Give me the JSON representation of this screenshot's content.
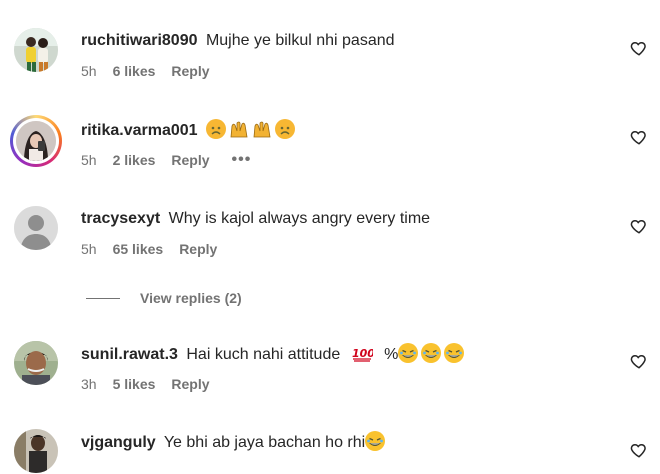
{
  "comments": [
    {
      "username": "ruchitiwari8090",
      "text": "Mujhe ye bilkul nhi pasand",
      "time": "5h",
      "likes": "6 likes",
      "reply": "Reply",
      "emojis": []
    },
    {
      "username": "ritika.varma001",
      "text": "",
      "time": "5h",
      "likes": "2 likes",
      "reply": "Reply",
      "more": "•••",
      "emojis": [
        "disappointed-face-emoji",
        "raising-hands-emoji",
        "raising-hands-emoji",
        "disappointed-face-emoji"
      ]
    },
    {
      "username": "tracysexyt",
      "text": "Why is kajol always angry every time",
      "time": "5h",
      "likes": "65 likes",
      "reply": "Reply",
      "emojis": []
    },
    {
      "username": "sunil.rawat.3",
      "text": "Hai kuch nahi attitude",
      "text_suffix": "%",
      "time": "3h",
      "likes": "5 likes",
      "reply": "Reply",
      "emojis": [
        "hundred-points-emoji",
        "laughing-face-emoji",
        "laughing-face-emoji",
        "laughing-face-emoji"
      ]
    },
    {
      "username": "vjganguly",
      "text": "Ye bhi ab jaya bachan ho rhi",
      "emojis": [
        "laughing-face-emoji"
      ]
    }
  ],
  "view_replies": "View replies (2)",
  "icons": {
    "like": "heart-outline-icon"
  },
  "colors": {
    "text": "#262626",
    "secondary": "#737373",
    "emoji_yellow": "#f9c22e"
  }
}
